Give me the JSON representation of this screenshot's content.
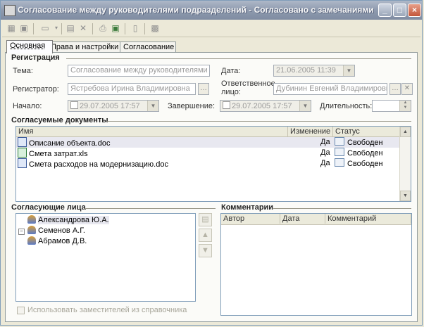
{
  "window": {
    "title": "Согласование между руководителями подразделений - Согласовано с замечаниями"
  },
  "tabs": [
    {
      "label": "Основная"
    },
    {
      "label": "Права и настройки"
    },
    {
      "label": "Согласование"
    }
  ],
  "registration": {
    "section_title": "Регистрация",
    "topic_label": "Тема:",
    "topic_value": "Согласование между руководителями под",
    "date_label": "Дата:",
    "date_value": "21.06.2005 11:39",
    "registrar_label": "Регистратор:",
    "registrar_value": "Ястребова Ирина Владимировна",
    "responsible_label_line1": "Ответственное",
    "responsible_label_line2": "лицо:",
    "responsible_value": "Дубинин Евгений Владимирович",
    "start_label": "Начало:",
    "start_value": "29.07.2005 17:57",
    "end_label": "Завершение:",
    "end_value": "29.07.2005 17:57",
    "duration_label": "Длительность:",
    "duration_value": ""
  },
  "documents": {
    "section_title": "Согласуемые документы",
    "columns": [
      "Имя",
      "Изменение",
      "Статус"
    ],
    "rows": [
      {
        "name": "Описание объекта.doc",
        "type": "doc",
        "changed": "Да",
        "status": "Свободен"
      },
      {
        "name": "Смета затрат.xls",
        "type": "xls",
        "changed": "Да",
        "status": "Свободен"
      },
      {
        "name": "Смета расходов на модернизацию.doc",
        "type": "doc",
        "changed": "Да",
        "status": "Свободен"
      }
    ]
  },
  "approvers": {
    "section_title": "Согласующие лица",
    "items": [
      {
        "name": "Александрова Ю.А."
      },
      {
        "name": "Семенов А.Г.",
        "expander": "−"
      },
      {
        "name": "Абрамов Д.В."
      }
    ],
    "use_substitutes_label": "Использовать заместителей из справочника"
  },
  "comments": {
    "section_title": "Комментарии",
    "columns": [
      "Автор",
      "Дата",
      "Комментарий"
    ]
  },
  "icons": {
    "ellipsis": "…",
    "clear": "✕",
    "dropdown": "▼",
    "up": "▲",
    "down": "▼"
  }
}
